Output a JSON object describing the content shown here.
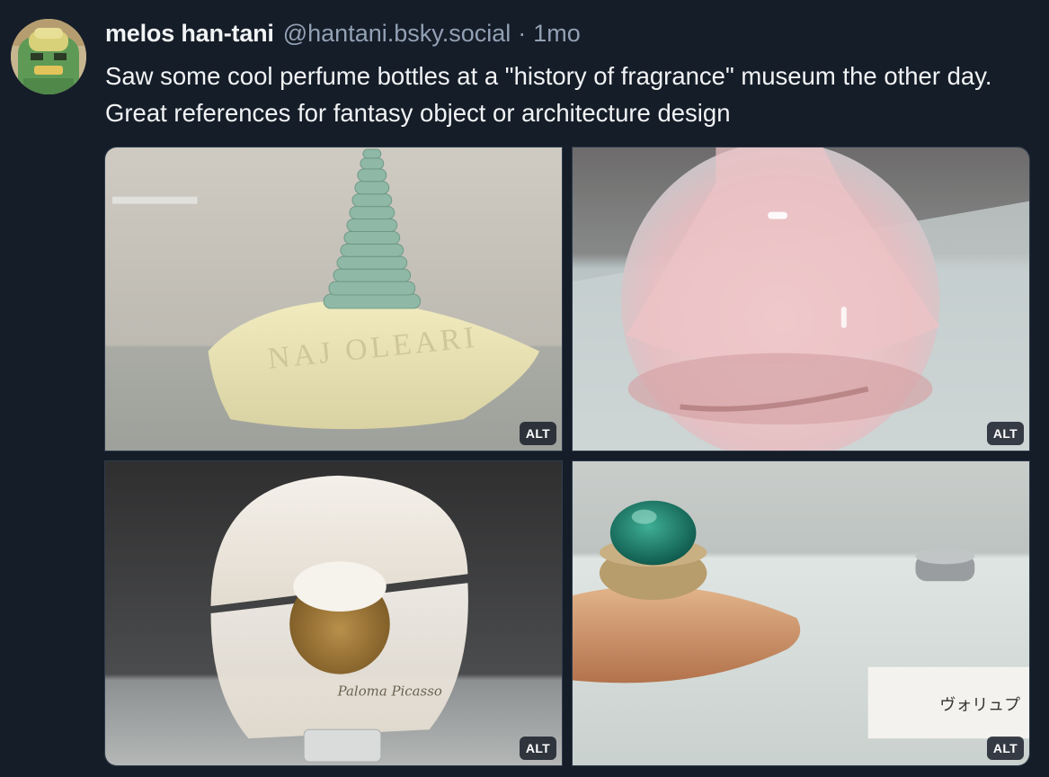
{
  "post": {
    "author": {
      "display_name": "melos han-tani",
      "handle": "@hantani.bsky.social"
    },
    "separator": "·",
    "timestamp": "1mo",
    "text": "Saw some cool perfume bottles at a \"history of fragrance\" museum the other day. Great references for fantasy object or architecture design",
    "images": [
      {
        "alt_label": "ALT",
        "engraving": "NAJ OLEARI"
      },
      {
        "alt_label": "ALT"
      },
      {
        "alt_label": "ALT",
        "signature": "Paloma Picasso"
      },
      {
        "alt_label": "ALT",
        "placard": "ヴォリュプ"
      }
    ]
  },
  "colors": {
    "background": "#151d28",
    "text_primary": "#f1f3f5",
    "text_secondary": "#93a1b5",
    "alt_badge_bg": "#141a24"
  }
}
